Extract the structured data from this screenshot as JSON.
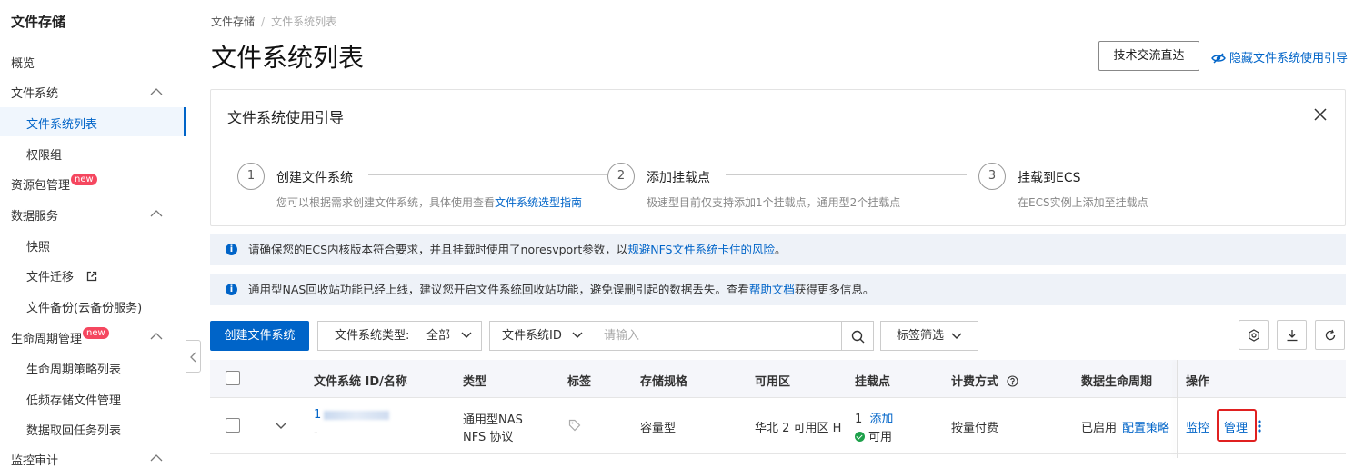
{
  "sidebar": {
    "title": "文件存储",
    "items": [
      {
        "label": "概览"
      },
      {
        "label": "文件系统"
      },
      {
        "label": "文件系统列表"
      },
      {
        "label": "权限组"
      },
      {
        "label": "资源包管理",
        "badge": "new"
      },
      {
        "label": "数据服务"
      },
      {
        "label": "快照"
      },
      {
        "label": "文件迁移"
      },
      {
        "label": "文件备份(云备份服务)"
      },
      {
        "label": "生命周期管理",
        "badge": "new"
      },
      {
        "label": "生命周期策略列表"
      },
      {
        "label": "低频存储文件管理"
      },
      {
        "label": "数据取回任务列表"
      },
      {
        "label": "监控审计"
      }
    ]
  },
  "breadcrumb": {
    "root": "文件存储",
    "sep": "/",
    "current": "文件系统列表"
  },
  "page_title": "文件系统列表",
  "header": {
    "tech_button": "技术交流直达",
    "hide_guide": "隐藏文件系统使用引导"
  },
  "guide": {
    "title": "文件系统使用引导",
    "steps": [
      {
        "num": "1",
        "title": "创建文件系统",
        "desc": "您可以根据需求创建文件系统，具体使用查看",
        "link": "文件系统选型指南"
      },
      {
        "num": "2",
        "title": "添加挂载点",
        "desc": "极速型目前仅支持添加1个挂载点，通用型2个挂载点"
      },
      {
        "num": "3",
        "title": "挂载到ECS",
        "desc": "在ECS实例上添加至挂载点"
      }
    ]
  },
  "notices": [
    {
      "text": "请确保您的ECS内核版本符合要求，并且挂载时使用了noresvport参数，以",
      "link": "规避NFS文件系统卡住的风险",
      "suffix": "。"
    },
    {
      "text": "通用型NAS回收站功能已经上线，建议您开启文件系统回收站功能，避免误删引起的数据丢失。查看",
      "link": "帮助文档",
      "suffix": "获得更多信息。"
    }
  ],
  "toolbar": {
    "create_button": "创建文件系统",
    "type_filter_label": "文件系统类型:",
    "type_filter_value": "全部",
    "search_field": "文件系统ID",
    "search_placeholder": "请输入",
    "tag_filter": "标签筛选"
  },
  "table": {
    "columns": [
      "文件系统 ID/名称",
      "类型",
      "标签",
      "存储规格",
      "可用区",
      "挂载点",
      "计费方式",
      "数据生命周期",
      "操作"
    ],
    "rows": [
      {
        "id_prefix": "1",
        "name": "-",
        "type_line1": "通用型NAS",
        "type_line2": "NFS 协议",
        "storage": "容量型",
        "zone": "华北 2 可用区 H",
        "mount_count": "1",
        "mount_add": "添加",
        "mount_status": "可用",
        "billing": "按量付费",
        "lifecycle_status": "已启用",
        "lifecycle_link": "配置策略",
        "actions": [
          "监控",
          "管理"
        ]
      }
    ]
  },
  "colors": {
    "accent": "#0064c8",
    "badge": "#f5475f",
    "highlight": "#e02020",
    "ok": "#1ea14b"
  }
}
